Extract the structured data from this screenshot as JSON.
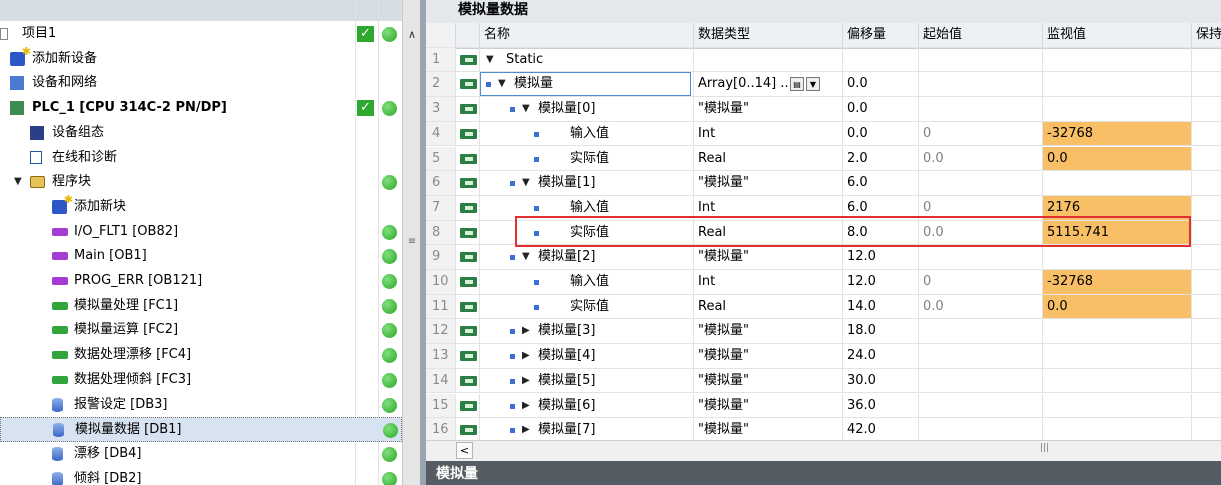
{
  "editor": {
    "title": "模拟量数据",
    "headers": {
      "name": "名称",
      "type": "数据类型",
      "offset": "偏移量",
      "start": "起始值",
      "monitor": "监视值",
      "retain": "保持"
    },
    "array_type": "Array[0..14] ...",
    "rows": [
      {
        "num": "1",
        "name": "Static",
        "type": "",
        "offset": "",
        "start": "",
        "monitor": ""
      },
      {
        "num": "2",
        "name": "模拟量",
        "type": "",
        "offset": "0.0",
        "start": "",
        "monitor": ""
      },
      {
        "num": "3",
        "name": "模拟量[0]",
        "type": "\"模拟量\"",
        "offset": "0.0",
        "start": "",
        "monitor": ""
      },
      {
        "num": "4",
        "name": "输入值",
        "type": "Int",
        "offset": "0.0",
        "start": "0",
        "monitor": "-32768"
      },
      {
        "num": "5",
        "name": "实际值",
        "type": "Real",
        "offset": "2.0",
        "start": "0.0",
        "monitor": "0.0"
      },
      {
        "num": "6",
        "name": "模拟量[1]",
        "type": "\"模拟量\"",
        "offset": "6.0",
        "start": "",
        "monitor": ""
      },
      {
        "num": "7",
        "name": "输入值",
        "type": "Int",
        "offset": "6.0",
        "start": "0",
        "monitor": "2176"
      },
      {
        "num": "8",
        "name": "实际值",
        "type": "Real",
        "offset": "8.0",
        "start": "0.0",
        "monitor": "5115.741"
      },
      {
        "num": "9",
        "name": "模拟量[2]",
        "type": "\"模拟量\"",
        "offset": "12.0",
        "start": "",
        "monitor": ""
      },
      {
        "num": "10",
        "name": "输入值",
        "type": "Int",
        "offset": "12.0",
        "start": "0",
        "monitor": "-32768"
      },
      {
        "num": "11",
        "name": "实际值",
        "type": "Real",
        "offset": "14.0",
        "start": "0.0",
        "monitor": "0.0"
      },
      {
        "num": "12",
        "name": "模拟量[3]",
        "type": "\"模拟量\"",
        "offset": "18.0",
        "start": "",
        "monitor": ""
      },
      {
        "num": "13",
        "name": "模拟量[4]",
        "type": "\"模拟量\"",
        "offset": "24.0",
        "start": "",
        "monitor": ""
      },
      {
        "num": "14",
        "name": "模拟量[5]",
        "type": "\"模拟量\"",
        "offset": "30.0",
        "start": "",
        "monitor": ""
      },
      {
        "num": "15",
        "name": "模拟量[6]",
        "type": "\"模拟量\"",
        "offset": "36.0",
        "start": "",
        "monitor": ""
      },
      {
        "num": "16",
        "name": "模拟量[7]",
        "type": "\"模拟量\"",
        "offset": "42.0",
        "start": "",
        "monitor": ""
      }
    ],
    "bottom_panel_title": "模拟量"
  },
  "tree": {
    "items": [
      {
        "label": "项目1",
        "icon": "project-icon"
      },
      {
        "label": "添加新设备",
        "icon": "add-device-icon"
      },
      {
        "label": "设备和网络",
        "icon": "network-icon"
      },
      {
        "label": "PLC_1 [CPU 314C-2 PN/DP]",
        "icon": "plc-icon"
      },
      {
        "label": "设备组态",
        "icon": "device-config-icon"
      },
      {
        "label": "在线和诊断",
        "icon": "diagnostics-icon"
      },
      {
        "label": "程序块",
        "icon": "folder-icon"
      },
      {
        "label": "添加新块",
        "icon": "add-block-icon"
      },
      {
        "label": "I/O_FLT1 [OB82]",
        "icon": "ob-icon"
      },
      {
        "label": "Main [OB1]",
        "icon": "ob-icon"
      },
      {
        "label": "PROG_ERR [OB121]",
        "icon": "ob-icon"
      },
      {
        "label": "模拟量处理 [FC1]",
        "icon": "fc-icon"
      },
      {
        "label": "模拟量运算 [FC2]",
        "icon": "fc-icon"
      },
      {
        "label": "数据处理漂移 [FC4]",
        "icon": "fc-icon"
      },
      {
        "label": "数据处理倾斜 [FC3]",
        "icon": "fc-icon"
      },
      {
        "label": "报警设定 [DB3]",
        "icon": "db-icon"
      },
      {
        "label": "模拟量数据 [DB1]",
        "icon": "db-icon"
      },
      {
        "label": "漂移 [DB4]",
        "icon": "db-icon"
      },
      {
        "label": "倾斜 [DB2]",
        "icon": "db-icon"
      }
    ]
  },
  "colors": {
    "monitor_highlight": "#f8bf66",
    "selection_box": "#e03030",
    "status_ok": "#2aa52a"
  }
}
